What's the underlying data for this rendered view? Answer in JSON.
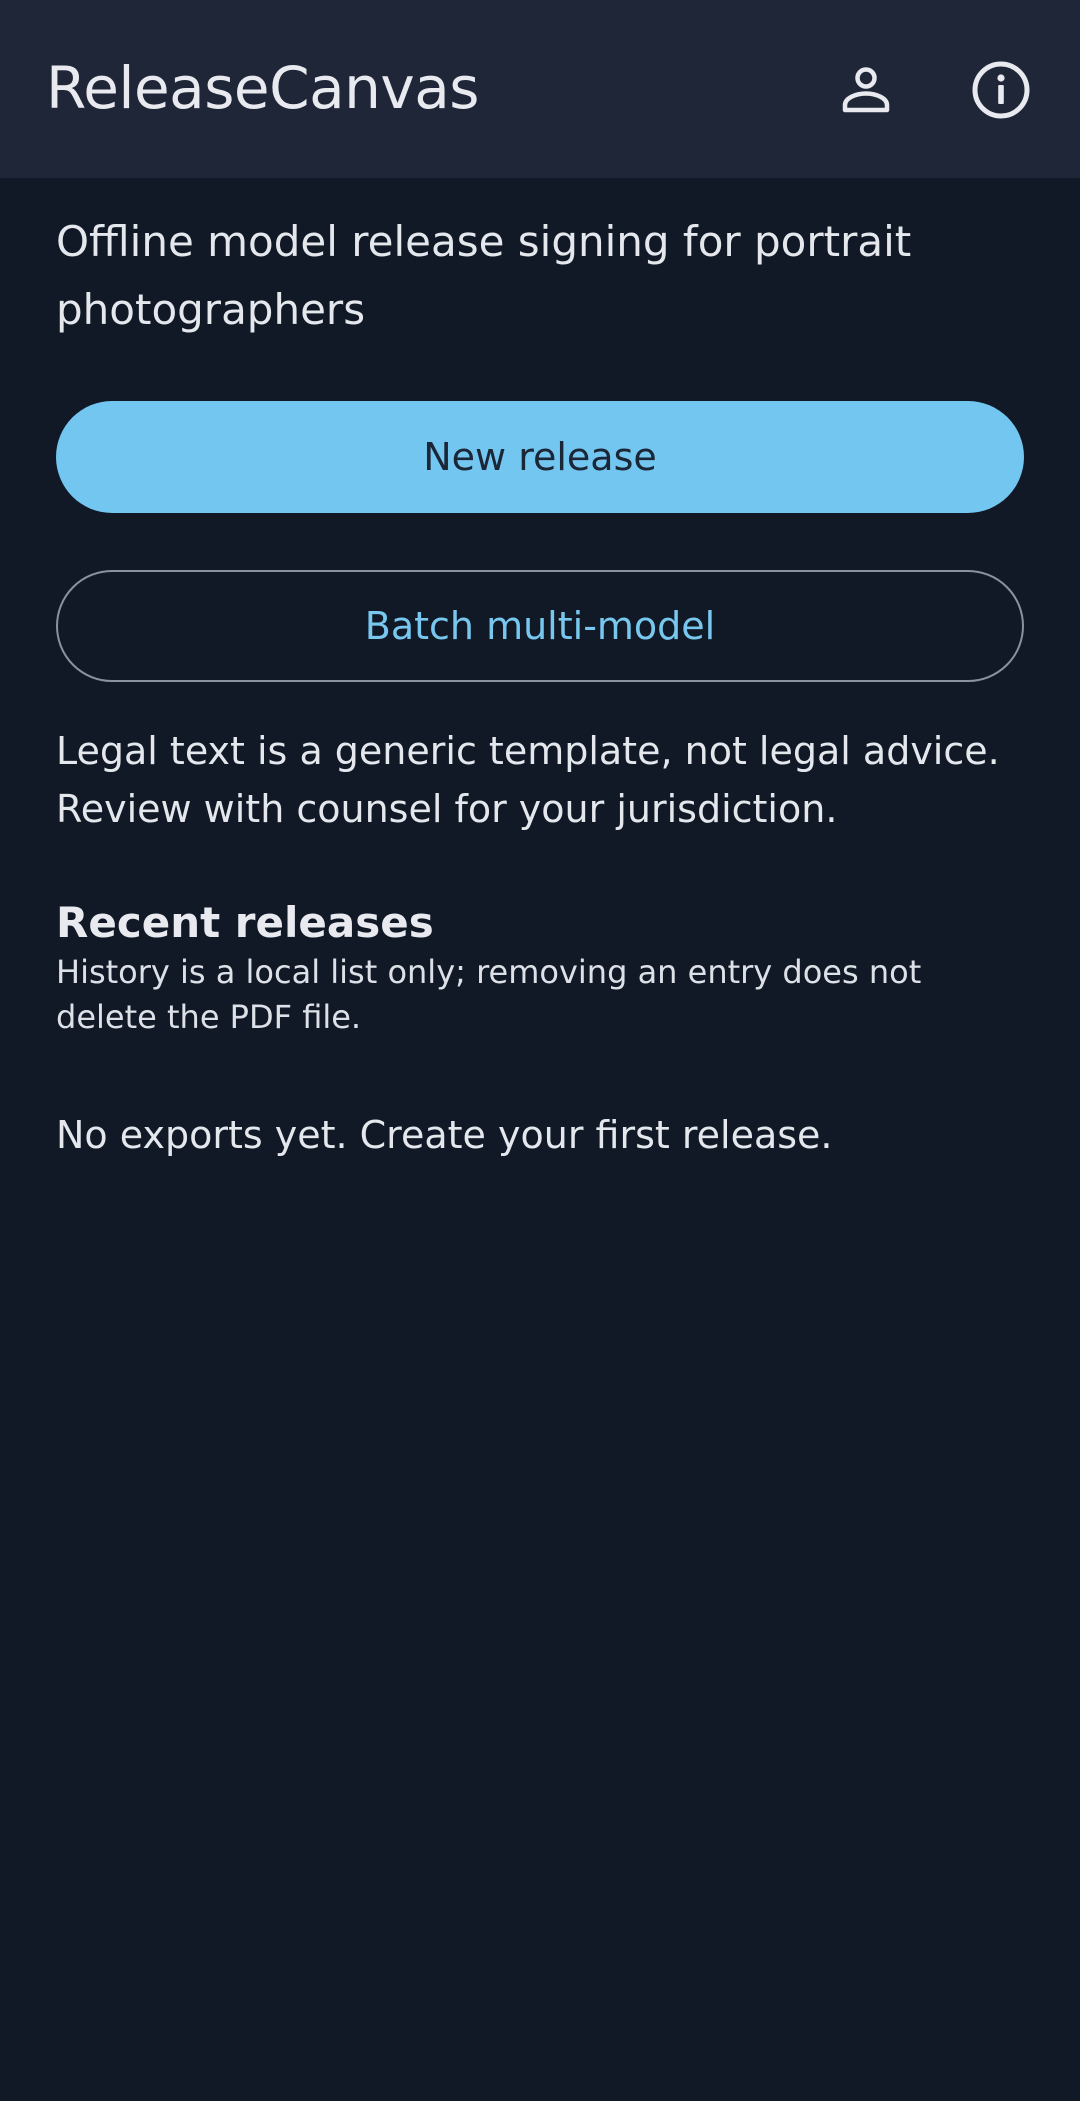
{
  "app_bar": {
    "title": "ReleaseCanvas",
    "profile_icon": "person-icon",
    "info_icon": "info-icon"
  },
  "main": {
    "subtitle": "Offline model release signing for portrait photographers",
    "new_release_label": "New release",
    "batch_label": "Batch multi-model",
    "disclaimer": "Legal text is a generic template, not legal advice. Review with counsel for your jurisdiction.",
    "recent": {
      "title": "Recent releases",
      "note": "History is a local list only; removing an entry does not delete the PDF file.",
      "empty_message": "No exports yet. Create your first release."
    }
  },
  "colors": {
    "background": "#111927",
    "app_bar": "#1e2638",
    "accent": "#72c6ef",
    "outline": "#8b929e"
  }
}
